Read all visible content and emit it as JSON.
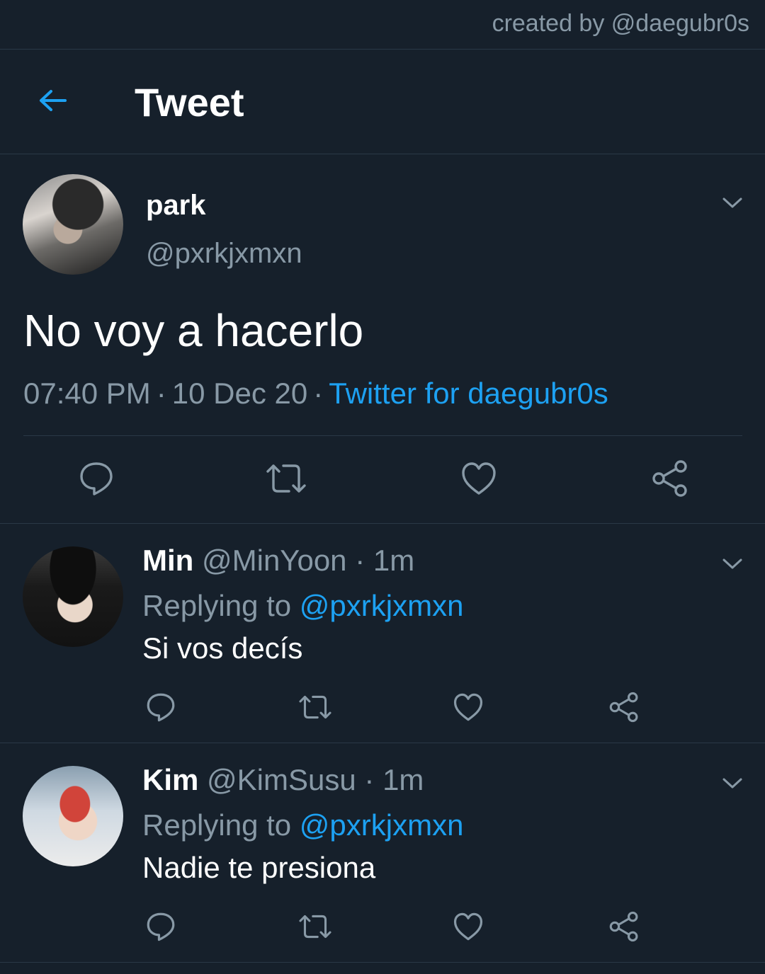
{
  "watermark": "created by @daegubr0s",
  "header": {
    "title": "Tweet"
  },
  "tweet": {
    "name": "park",
    "handle": "@pxrkjxmxn",
    "text": "No voy a hacerlo",
    "time": "07:40 PM",
    "date": "10 Dec 20",
    "separator": "·",
    "source": "Twitter for daegubr0s"
  },
  "replies": [
    {
      "name": "Min",
      "handle": "@MinYoon",
      "dot": "·",
      "time": "1m",
      "replying_label": "Replying to",
      "mention": "@pxrkjxmxn",
      "text": "Si vos decís"
    },
    {
      "name": "Kim",
      "handle": "@KimSusu",
      "dot": "·",
      "time": "1m",
      "replying_label": "Replying to",
      "mention": "@pxrkjxmxn",
      "text": "Nadie te presiona"
    }
  ],
  "colors": {
    "background": "#16202b",
    "accent": "#1da1f2",
    "muted": "#8899a6",
    "divider": "#2a3846"
  },
  "icons": [
    "back-arrow-icon",
    "chevron-down-icon",
    "reply-icon",
    "retweet-icon",
    "like-icon",
    "share-icon"
  ]
}
